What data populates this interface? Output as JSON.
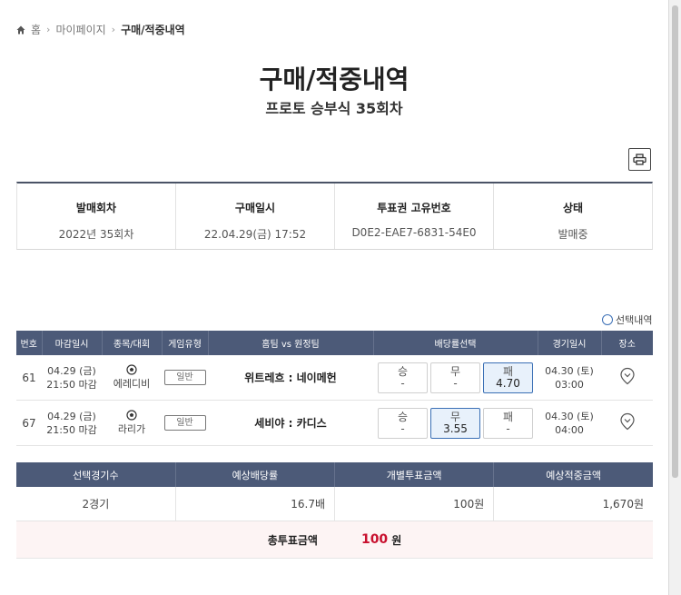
{
  "breadcrumb": {
    "home": "홈",
    "mypage": "마이페이지",
    "current": "구매/적중내역"
  },
  "page": {
    "title": "구매/적중내역",
    "subtitle": "프로토 승부식 35회차"
  },
  "info": [
    {
      "label": "발매회차",
      "value": "2022년 35회차"
    },
    {
      "label": "구매일시",
      "value": "22.04.29(금) 17:52"
    },
    {
      "label": "투표권 고유번호",
      "value": "D0E2-EAE7-6831-54E0"
    },
    {
      "label": "상태",
      "value": "발매중"
    }
  ],
  "select_toggle": "선택내역",
  "games": {
    "headers": [
      "번호",
      "마감일시",
      "종목/대회",
      "게임유형",
      "홈팀 vs 원정팀",
      "배당률선택",
      "경기일시",
      "장소"
    ],
    "rows": [
      {
        "no": "61",
        "close_date": "04.29 (금)",
        "close_time": "21:50 마감",
        "league": "에레디비",
        "type": "일반",
        "teams": "위트레흐 : 네이메헌",
        "odds": [
          {
            "label": "승",
            "value": "-",
            "selected": false
          },
          {
            "label": "무",
            "value": "-",
            "selected": false
          },
          {
            "label": "패",
            "value": "4.70",
            "selected": true
          }
        ],
        "match_date": "04.30 (토)",
        "match_time": "03:00"
      },
      {
        "no": "67",
        "close_date": "04.29 (금)",
        "close_time": "21:50 마감",
        "league": "라리가",
        "type": "일반",
        "teams": "세비야 : 카디스",
        "odds": [
          {
            "label": "승",
            "value": "-",
            "selected": false
          },
          {
            "label": "무",
            "value": "3.55",
            "selected": true
          },
          {
            "label": "패",
            "value": "-",
            "selected": false
          }
        ],
        "match_date": "04.30 (토)",
        "match_time": "04:00"
      }
    ]
  },
  "summary": {
    "headers": [
      "선택경기수",
      "예상배당률",
      "개별투표금액",
      "예상적중금액"
    ],
    "values": [
      "2경기",
      "16.7배",
      "100원",
      "1,670원"
    ],
    "total_label": "총투표금액",
    "total_amount": "100",
    "total_unit": "원"
  },
  "colors": {
    "header_bg": "#4c5a78",
    "accent_red": "#c8102e",
    "selected_border": "#3a6fb5"
  }
}
